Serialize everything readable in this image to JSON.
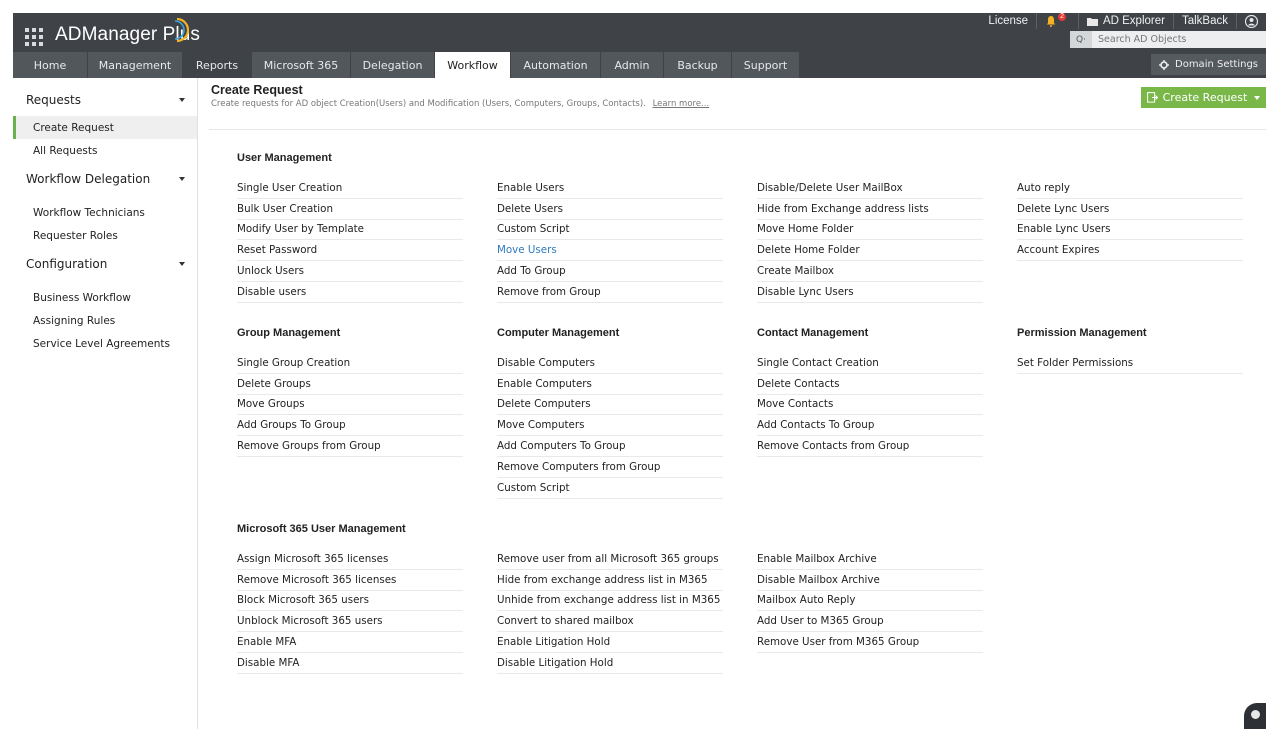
{
  "app": {
    "name": "ADManager Plus",
    "brand_color": "#79b749"
  },
  "header": {
    "links": {
      "license": "License",
      "notification_count": "2",
      "ad_explorer": "AD Explorer",
      "talkback": "TalkBack"
    },
    "search_placeholder": "Search AD Objects",
    "nav_tabs": [
      "Home",
      "Management",
      "Reports",
      "Microsoft 365",
      "Delegation",
      "Workflow",
      "Automation",
      "Admin",
      "Backup",
      "Support"
    ],
    "active_tab": "Workflow",
    "domain_settings": "Domain Settings"
  },
  "sidebar": {
    "sections": [
      {
        "label": "Requests",
        "items": [
          "Create Request",
          "All Requests"
        ]
      },
      {
        "label": "Workflow Delegation",
        "items": [
          "Workflow Technicians",
          "Requester Roles"
        ]
      },
      {
        "label": "Configuration",
        "items": [
          "Business Workflow",
          "Assigning Rules",
          "Service Level Agreements"
        ]
      }
    ],
    "active_item": "Create Request"
  },
  "main": {
    "title": "Create Request",
    "description": "Create requests for AD object Creation(Users) and Modification (Users, Computers, Groups, Contacts).",
    "learn_more": "Learn more...",
    "create_button": "Create Request",
    "user_management": {
      "title": "User Management",
      "columns": [
        [
          "Single User Creation",
          "Bulk User Creation",
          "Modify User by Template",
          "Reset Password",
          "Unlock Users",
          "Disable users"
        ],
        [
          "Enable Users",
          "Delete Users",
          "Custom Script",
          "Move Users",
          "Add To Group",
          "Remove from Group"
        ],
        [
          "Disable/Delete User MailBox",
          "Hide from Exchange address lists",
          "Move Home Folder",
          "Delete Home Folder",
          "Create Mailbox",
          "Disable Lync Users"
        ],
        [
          "Auto reply",
          "Delete Lync Users",
          "Enable Lync Users",
          "Account Expires"
        ]
      ],
      "highlighted": "Move Users"
    },
    "group_management": {
      "title": "Group Management",
      "items": [
        "Single Group Creation",
        "Delete Groups",
        "Move Groups",
        "Add Groups To Group",
        "Remove Groups from Group"
      ]
    },
    "computer_management": {
      "title": "Computer Management",
      "items": [
        "Disable Computers",
        "Enable Computers",
        "Delete Computers",
        "Move Computers",
        "Add Computers To Group",
        "Remove Computers from Group",
        "Custom Script"
      ]
    },
    "contact_management": {
      "title": "Contact Management",
      "items": [
        "Single Contact Creation",
        "Delete Contacts",
        "Move Contacts",
        "Add Contacts To Group",
        "Remove Contacts from Group"
      ]
    },
    "permission_management": {
      "title": "Permission Management",
      "items": [
        "Set Folder Permissions"
      ]
    },
    "m365_user_management": {
      "title": "Microsoft 365 User Management",
      "columns": [
        [
          "Assign Microsoft 365 licenses",
          "Remove Microsoft 365 licenses",
          "Block Microsoft 365 users",
          "Unblock Microsoft 365 users",
          "Enable MFA",
          "Disable MFA"
        ],
        [
          "Remove user from all Microsoft 365 groups",
          "Hide from exchange address list in M365",
          "Unhide from exchange address list in M365",
          "Convert to shared mailbox",
          "Enable Litigation Hold",
          "Disable Litigation Hold"
        ],
        [
          "Enable Mailbox Archive",
          "Disable Mailbox Archive",
          "Mailbox Auto Reply",
          "Add User to M365 Group",
          "Remove User from M365 Group"
        ]
      ]
    }
  }
}
